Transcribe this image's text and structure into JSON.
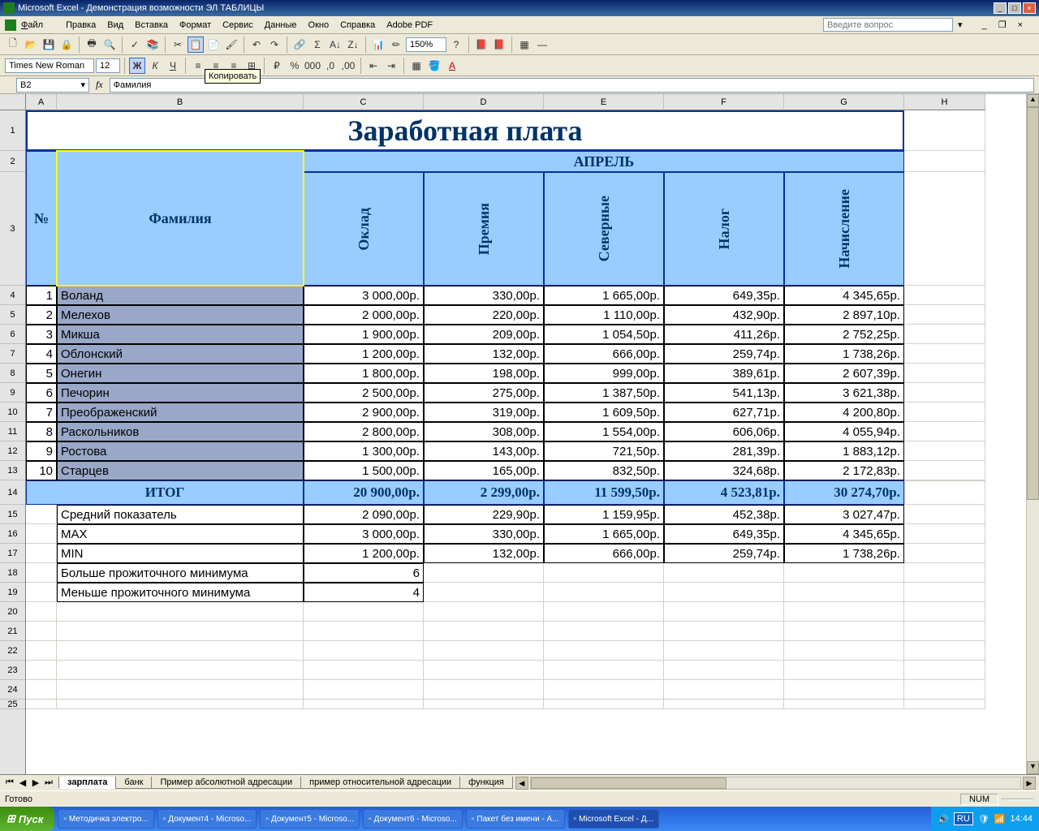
{
  "window": {
    "title": "Microsoft Excel - Демонстрация возможности ЭЛ ТАБЛИЦЫ"
  },
  "menu": {
    "file": "Файл",
    "edit": "Правка",
    "view": "Вид",
    "insert": "Вставка",
    "format": "Формат",
    "tools": "Сервис",
    "data": "Данные",
    "window": "Окно",
    "help": "Справка",
    "adobe": "Adobe PDF"
  },
  "askbox_placeholder": "Введите вопрос",
  "tooltip": "Копировать",
  "font": {
    "name": "Times New Roman",
    "size": "12"
  },
  "zoom": "150%",
  "namebox": "B2",
  "formula": "Фамилия",
  "cols": {
    "A": "A",
    "B": "B",
    "C": "C",
    "D": "D",
    "E": "E",
    "F": "F",
    "G": "G",
    "H": "H"
  },
  "title": "Заработная плата",
  "headers": {
    "num": "№",
    "surname": "Фамилия",
    "month": "АПРЕЛЬ",
    "oklad": "Оклад",
    "premia": "Премия",
    "severnye": "Северные",
    "nalog": "Налог",
    "nachislenie": "Начисление"
  },
  "rows": [
    {
      "n": "1",
      "name": "Воланд",
      "c": "3 000,00р.",
      "d": "330,00р.",
      "e": "1 665,00р.",
      "f": "649,35р.",
      "g": "4 345,65р."
    },
    {
      "n": "2",
      "name": "Мелехов",
      "c": "2 000,00р.",
      "d": "220,00р.",
      "e": "1 110,00р.",
      "f": "432,90р.",
      "g": "2 897,10р."
    },
    {
      "n": "3",
      "name": "Микша",
      "c": "1 900,00р.",
      "d": "209,00р.",
      "e": "1 054,50р.",
      "f": "411,26р.",
      "g": "2 752,25р."
    },
    {
      "n": "4",
      "name": "Облонский",
      "c": "1 200,00р.",
      "d": "132,00р.",
      "e": "666,00р.",
      "f": "259,74р.",
      "g": "1 738,26р."
    },
    {
      "n": "5",
      "name": "Онегин",
      "c": "1 800,00р.",
      "d": "198,00р.",
      "e": "999,00р.",
      "f": "389,61р.",
      "g": "2 607,39р."
    },
    {
      "n": "6",
      "name": "Печорин",
      "c": "2 500,00р.",
      "d": "275,00р.",
      "e": "1 387,50р.",
      "f": "541,13р.",
      "g": "3 621,38р."
    },
    {
      "n": "7",
      "name": "Преображенский",
      "c": "2 900,00р.",
      "d": "319,00р.",
      "e": "1 609,50р.",
      "f": "627,71р.",
      "g": "4 200,80р."
    },
    {
      "n": "8",
      "name": "Раскольников",
      "c": "2 800,00р.",
      "d": "308,00р.",
      "e": "1 554,00р.",
      "f": "606,06р.",
      "g": "4 055,94р."
    },
    {
      "n": "9",
      "name": "Ростова",
      "c": "1 300,00р.",
      "d": "143,00р.",
      "e": "721,50р.",
      "f": "281,39р.",
      "g": "1 883,12р."
    },
    {
      "n": "10",
      "name": "Старцев",
      "c": "1 500,00р.",
      "d": "165,00р.",
      "e": "832,50р.",
      "f": "324,68р.",
      "g": "2 172,83р."
    }
  ],
  "total": {
    "label": "ИТОГ",
    "c": "20 900,00р.",
    "d": "2 299,00р.",
    "e": "11 599,50р.",
    "f": "4 523,81р.",
    "g": "30 274,70р."
  },
  "stats": [
    {
      "label": "Средний показатель",
      "c": "2 090,00р.",
      "d": "229,90р.",
      "e": "1 159,95р.",
      "f": "452,38р.",
      "g": "3 027,47р."
    },
    {
      "label": "MAX",
      "c": "3 000,00р.",
      "d": "330,00р.",
      "e": "1 665,00р.",
      "f": "649,35р.",
      "g": "4 345,65р."
    },
    {
      "label": "MIN",
      "c": "1 200,00р.",
      "d": "132,00р.",
      "e": "666,00р.",
      "f": "259,74р.",
      "g": "1 738,26р."
    }
  ],
  "extra": [
    {
      "label": "Больше прожиточного минимума",
      "val": "6"
    },
    {
      "label": "Меньше прожиточного минимума",
      "val": "4"
    }
  ],
  "sheets": [
    "зарплата",
    "банк",
    "Пример абсолютной адресации",
    "пример относительной адресации",
    "функция"
  ],
  "status": {
    "ready": "Готово",
    "num": "NUM"
  },
  "taskbar": {
    "start": "Пуск",
    "items": [
      "Методичка электро...",
      "Документ4 - Microso...",
      "Документ5 - Microso...",
      "Документ6 - Microso...",
      "Пакет без имени - A...",
      "Microsoft Excel - Д..."
    ],
    "lang": "RU",
    "time": "14:44"
  }
}
